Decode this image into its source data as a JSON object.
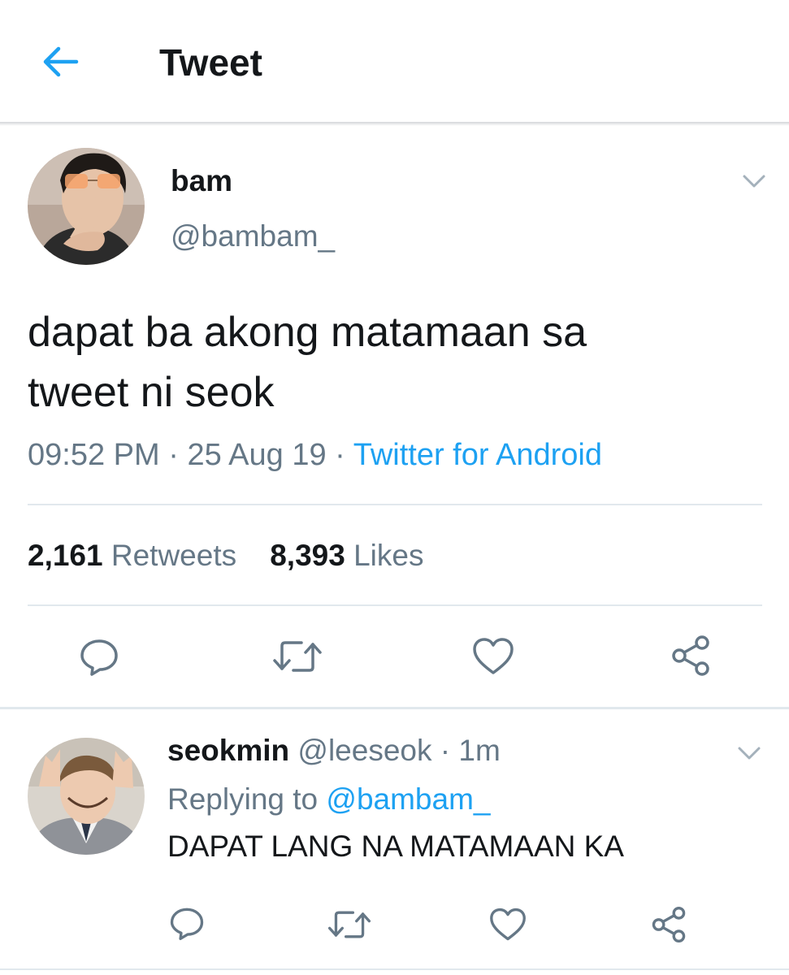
{
  "header": {
    "title": "Tweet",
    "back_icon": "arrow-left-icon",
    "accent": "#1da1f2"
  },
  "tweet": {
    "display_name": "bam",
    "handle": "@bambam_",
    "text_line1": "dapat ba akong matamaan sa",
    "text_line2": "tweet ni seok",
    "time": "09:52 PM",
    "date": "25 Aug 19",
    "separator": "·",
    "source": "Twitter for Android",
    "retweets_count": "2,161",
    "retweets_label": "Retweets",
    "likes_count": "8,393",
    "likes_label": "Likes"
  },
  "reply": {
    "display_name": "seokmin",
    "handle": "@leeseok",
    "separator": "·",
    "time": "1m",
    "replying_label": "Replying to",
    "replying_to": "@bambam_",
    "text": "DAPAT LANG NA MATAMAAN KA"
  },
  "actions": [
    "reply-icon",
    "retweet-icon",
    "like-icon",
    "share-icon"
  ],
  "colors": {
    "text": "#14171a",
    "secondary": "#657786",
    "link": "#1da1f2",
    "divider": "#e1e8ed"
  }
}
